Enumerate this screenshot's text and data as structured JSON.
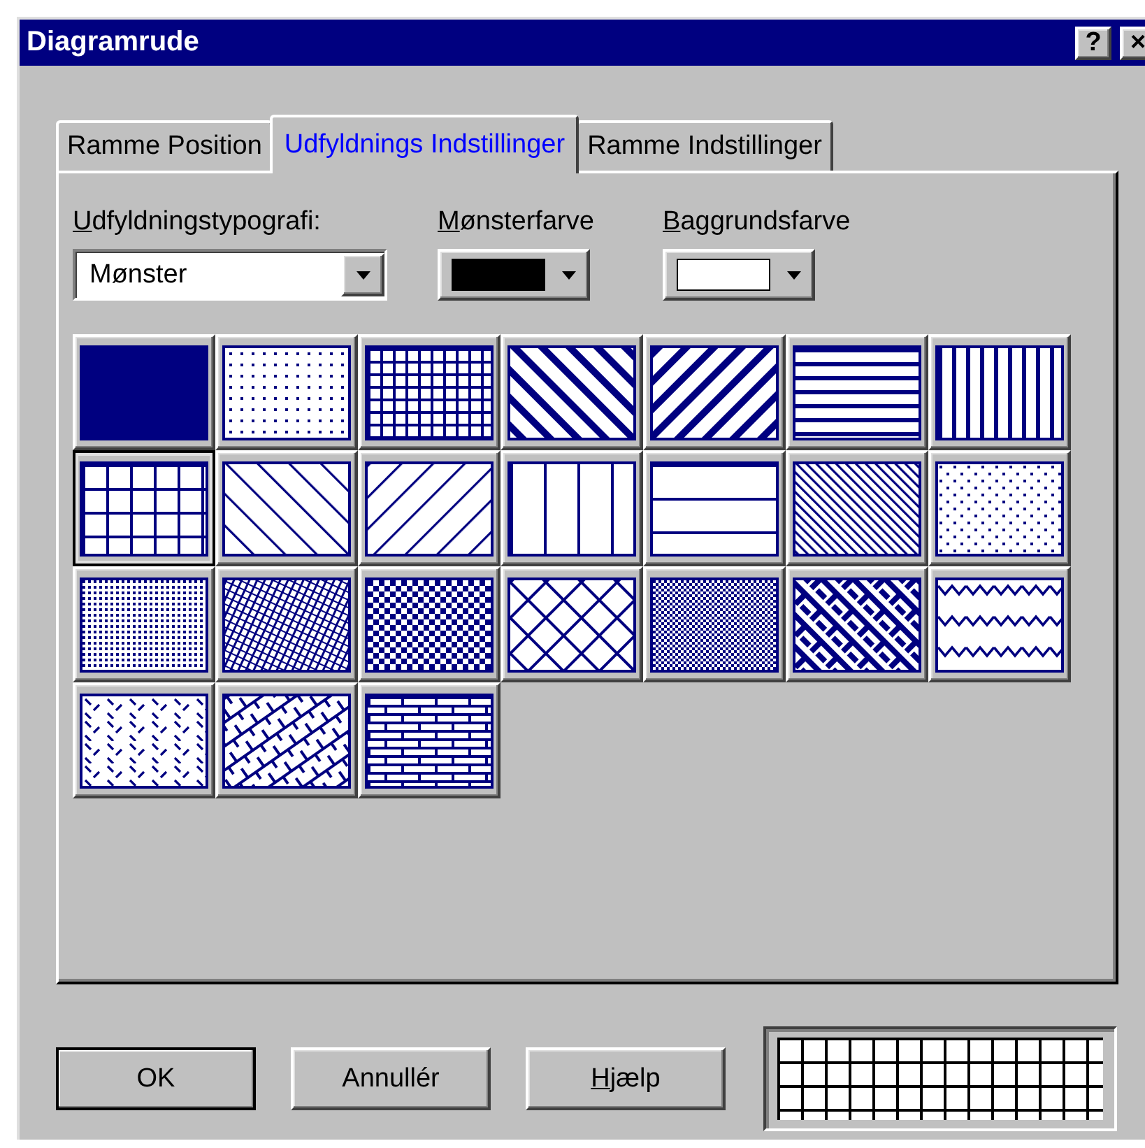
{
  "window": {
    "title": "Diagramrude",
    "controls": [
      {
        "kind": "help",
        "label": "?"
      },
      {
        "kind": "close",
        "label": "×"
      }
    ]
  },
  "tabs": [
    {
      "label": "Ramme Position",
      "selected": false
    },
    {
      "label": "Udfyldnings Indstillinger",
      "selected": true
    },
    {
      "label": "Ramme Indstillinger",
      "selected": false
    }
  ],
  "fill_style": {
    "label": "Udfyldningstypografi:",
    "underline_first": true,
    "value": "Mønster"
  },
  "pattern_color": {
    "label": "Mønsterfarve",
    "underline_first": true,
    "color": "#000000"
  },
  "background_color": {
    "label": "Baggrundsfarve",
    "underline_first": true,
    "color": "#ffffff"
  },
  "patterns": [
    {
      "kind": "solid",
      "selected": false
    },
    {
      "kind": "dots",
      "selected": false
    },
    {
      "kind": "small-grid",
      "selected": false
    },
    {
      "kind": "thick-diagonal-down",
      "selected": false
    },
    {
      "kind": "thick-diagonal-up",
      "selected": false
    },
    {
      "kind": "thick-horizontal",
      "selected": false
    },
    {
      "kind": "thick-vertical",
      "selected": false
    },
    {
      "kind": "large-grid",
      "selected": true
    },
    {
      "kind": "thin-diagonal-down",
      "selected": false
    },
    {
      "kind": "thin-diagonal-up",
      "selected": false
    },
    {
      "kind": "thin-vertical",
      "selected": false
    },
    {
      "kind": "thin-horizontal",
      "selected": false
    },
    {
      "kind": "dense-diagonal",
      "selected": false
    },
    {
      "kind": "sparse-dots",
      "selected": false
    },
    {
      "kind": "dense-dots",
      "selected": false
    },
    {
      "kind": "fine-weave",
      "selected": false
    },
    {
      "kind": "checker",
      "selected": false
    },
    {
      "kind": "diamond",
      "selected": false
    },
    {
      "kind": "fine-checker",
      "selected": false
    },
    {
      "kind": "weave",
      "selected": false
    },
    {
      "kind": "zigzag",
      "selected": false
    },
    {
      "kind": "dashes",
      "selected": false
    },
    {
      "kind": "shingle",
      "selected": false
    },
    {
      "kind": "brick",
      "selected": false
    }
  ],
  "buttons": [
    {
      "label": "OK",
      "default": true,
      "underline_first": false
    },
    {
      "label": "Annullér",
      "default": false,
      "underline_first": false
    },
    {
      "label": "Hjælp",
      "default": false,
      "underline_first": true
    }
  ]
}
